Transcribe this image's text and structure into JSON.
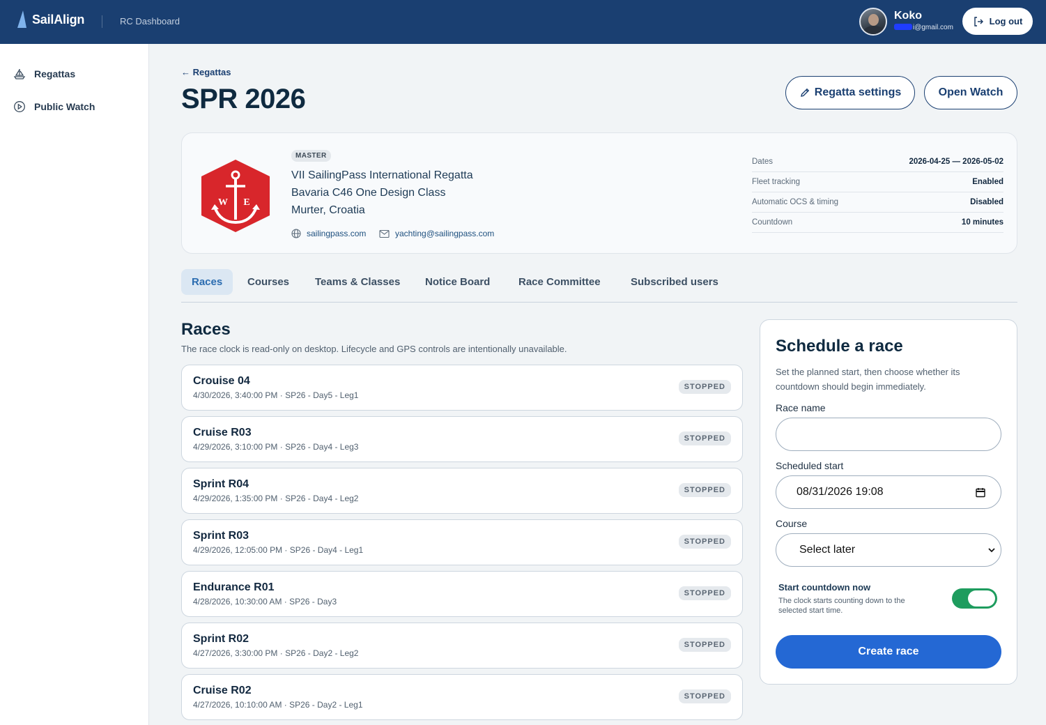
{
  "app": {
    "brand": "SailAlign",
    "section": "RC Dashboard"
  },
  "user": {
    "name": "Koko",
    "email_suffix": "i@gmail.com",
    "logout_label": "Log out"
  },
  "sidebar": {
    "items": [
      {
        "label": "Regattas",
        "icon": "sailboat-icon"
      },
      {
        "label": "Public Watch",
        "icon": "play-circle-icon"
      }
    ]
  },
  "header": {
    "back_label": "← Regattas",
    "title": "SPR 2026",
    "settings_label": "Regatta settings",
    "watch_label": "Open Watch"
  },
  "regatta": {
    "badge": "MASTER",
    "lines": [
      "VII SailingPass International Regatta",
      "Bavaria C46 One Design Class",
      "Murter, Croatia"
    ],
    "website": "sailingpass.com",
    "email": "yachting@sailingpass.com",
    "logo_letters": [
      "W",
      "E"
    ],
    "meta": [
      {
        "key": "Dates",
        "value": "2026-04-25 — 2026-05-02"
      },
      {
        "key": "Fleet tracking",
        "value": "Enabled"
      },
      {
        "key": "Automatic OCS & timing",
        "value": "Disabled"
      },
      {
        "key": "Countdown",
        "value": "10 minutes"
      }
    ]
  },
  "tabs": [
    "Races",
    "Courses",
    "Teams & Classes",
    "Notice Board",
    "Race Committee",
    "Subscribed users"
  ],
  "active_tab": "Races",
  "races": {
    "title": "Races",
    "subtitle": "The race clock is read-only on desktop. Lifecycle and GPS controls are intentionally unavailable.",
    "items": [
      {
        "name": "Crouise 04",
        "meta": "4/30/2026, 3:40:00 PM · SP26 - Day5 - Leg1",
        "status": "STOPPED"
      },
      {
        "name": "Cruise R03",
        "meta": "4/29/2026, 3:10:00 PM · SP26 - Day4 - Leg3",
        "status": "STOPPED"
      },
      {
        "name": "Sprint R04",
        "meta": "4/29/2026, 1:35:00 PM · SP26 - Day4 - Leg2",
        "status": "STOPPED"
      },
      {
        "name": "Sprint R03",
        "meta": "4/29/2026, 12:05:00 PM · SP26 - Day4 - Leg1",
        "status": "STOPPED"
      },
      {
        "name": "Endurance R01",
        "meta": "4/28/2026, 10:30:00 AM · SP26 - Day3",
        "status": "STOPPED"
      },
      {
        "name": "Sprint R02",
        "meta": "4/27/2026, 3:30:00 PM · SP26 - Day2 - Leg2",
        "status": "STOPPED"
      },
      {
        "name": "Cruise R02",
        "meta": "4/27/2026, 10:10:00 AM · SP26 - Day2 - Leg1",
        "status": "STOPPED"
      }
    ]
  },
  "schedule": {
    "title": "Schedule a race",
    "description": "Set the planned start, then choose whether its countdown should begin immediately.",
    "race_name_label": "Race name",
    "race_name_value": "",
    "start_label": "Scheduled start",
    "start_value": "08/31/2026 19:08",
    "course_label": "Course",
    "course_value": "Select later",
    "toggle_title": "Start countdown now",
    "toggle_desc": "The clock starts counting down to the selected start time.",
    "toggle_on": true,
    "create_label": "Create race"
  },
  "colors": {
    "topbar": "#1a3f71",
    "accent": "#2468d4",
    "toggle_on": "#1e9c5e",
    "logo_red": "#d8262b"
  }
}
